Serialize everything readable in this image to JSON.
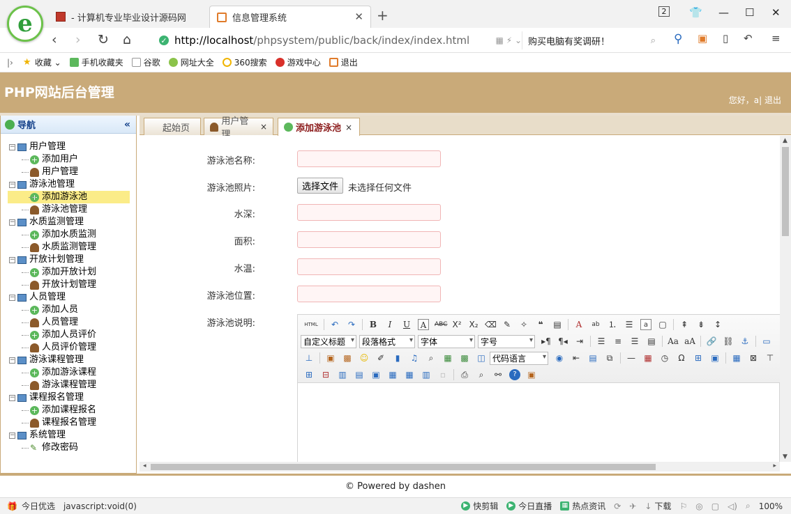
{
  "browser": {
    "tabs": [
      {
        "label": "- 计算机专业毕业设计源码网"
      },
      {
        "label": "信息管理系统"
      }
    ],
    "new_tab": "+",
    "url_host": "http://localhost",
    "url_path": "/phpsystem/public/back/index/index.html",
    "search_text": "购买电脑有奖调研！",
    "window_badge": "2"
  },
  "bookmarks": [
    "收藏",
    "手机收藏夹",
    "谷歌",
    "网址大全",
    "360搜索",
    "游戏中心",
    "退出"
  ],
  "app": {
    "title": "PHP网站后台管理",
    "greeting": "您好，a| 退出"
  },
  "sidebar": {
    "title": "导航",
    "collapse": "«",
    "tree": [
      {
        "label": "用户管理",
        "children": [
          {
            "label": "添加用户",
            "icon": "add"
          },
          {
            "label": "用户管理",
            "icon": "user"
          }
        ]
      },
      {
        "label": "游泳池管理",
        "children": [
          {
            "label": "添加游泳池",
            "icon": "add",
            "selected": true
          },
          {
            "label": "游泳池管理",
            "icon": "user"
          }
        ]
      },
      {
        "label": "水质监测管理",
        "children": [
          {
            "label": "添加水质监测",
            "icon": "add"
          },
          {
            "label": "水质监测管理",
            "icon": "user"
          }
        ]
      },
      {
        "label": "开放计划管理",
        "children": [
          {
            "label": "添加开放计划",
            "icon": "add"
          },
          {
            "label": "开放计划管理",
            "icon": "user"
          }
        ]
      },
      {
        "label": "人员管理",
        "children": [
          {
            "label": "添加人员",
            "icon": "add"
          },
          {
            "label": "人员管理",
            "icon": "user"
          },
          {
            "label": "添加人员评价",
            "icon": "add"
          },
          {
            "label": "人员评价管理",
            "icon": "user"
          }
        ]
      },
      {
        "label": "游泳课程管理",
        "children": [
          {
            "label": "添加游泳课程",
            "icon": "add"
          },
          {
            "label": "游泳课程管理",
            "icon": "user"
          }
        ]
      },
      {
        "label": "课程报名管理",
        "children": [
          {
            "label": "添加课程报名",
            "icon": "add"
          },
          {
            "label": "课程报名管理",
            "icon": "user"
          }
        ]
      },
      {
        "label": "系统管理",
        "children": [
          {
            "label": "修改密码",
            "icon": "pencil"
          }
        ]
      }
    ]
  },
  "content_tabs": [
    {
      "label": "起始页"
    },
    {
      "label": "用户管理",
      "close": "×"
    },
    {
      "label": "添加游泳池",
      "close": "×"
    }
  ],
  "form": {
    "name_label": "游泳池名称:",
    "photo_label": "游泳池照片:",
    "file_button": "选择文件",
    "file_status": "未选择任何文件",
    "depth_label": "水深:",
    "area_label": "面积:",
    "temp_label": "水温:",
    "location_label": "游泳池位置:",
    "desc_label": "游泳池说明:"
  },
  "editor": {
    "html_btn": "HTML",
    "selects": [
      "自定义标题",
      "段落格式",
      "字体",
      "字号",
      "代码语言"
    ]
  },
  "footer": "© Powered by dashen",
  "statusbar": {
    "left": "今日优选",
    "status_url": "javascript:void(0)",
    "items": [
      "快剪辑",
      "今日直播",
      "热点资讯",
      "下载"
    ],
    "zoom": "100%"
  }
}
